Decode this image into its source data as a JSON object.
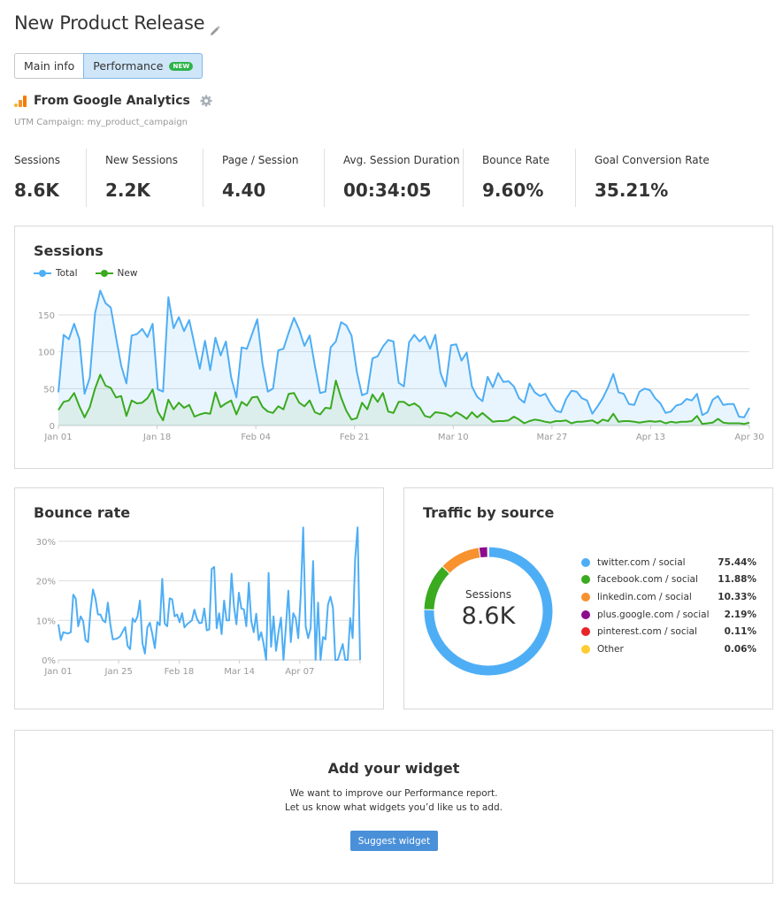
{
  "header": {
    "title": "New Product Release",
    "edit_icon": "pencil-icon"
  },
  "tabs": [
    {
      "label": "Main info",
      "active": false
    },
    {
      "label": "Performance",
      "active": true,
      "badge": "NEW"
    }
  ],
  "source": {
    "label": "From Google Analytics",
    "logo_icon": "google-analytics-logo",
    "settings_icon": "gear-icon",
    "utm": "UTM Campaign: my_product_campaign"
  },
  "metrics": [
    {
      "label": "Sessions",
      "value": "8.6K"
    },
    {
      "label": "New Sessions",
      "value": "2.2K"
    },
    {
      "label": "Page / Session",
      "value": "4.40"
    },
    {
      "label": "Avg. Session Duration",
      "value": "00:34:05"
    },
    {
      "label": "Bounce Rate",
      "value": "9.60%"
    },
    {
      "label": "Goal Conversion Rate",
      "value": "35.21%"
    }
  ],
  "colors": {
    "total": "#4eaef5",
    "new": "#3aaa1f",
    "accent_button": "#4a90d9",
    "badge": "#2db34a"
  },
  "chart_data": [
    {
      "id": "sessions",
      "type": "area",
      "title": "Sessions",
      "xlabel": "",
      "ylabel": "",
      "ylim": [
        0,
        150
      ],
      "yticks": [
        0,
        50,
        100,
        150
      ],
      "grid": true,
      "legend": "top-left",
      "x_tick_labels": [
        "Jan 01",
        "Jan 18",
        "Feb 04",
        "Feb 21",
        "Mar 10",
        "Mar 27",
        "Apr 13",
        "Apr 30"
      ],
      "x_range": [
        "Jan 01",
        "Apr 30"
      ],
      "series": [
        {
          "name": "Total",
          "color": "#4eaef5",
          "values": [
            45,
            123,
            117,
            138,
            117,
            43,
            65,
            152,
            183,
            166,
            160,
            120,
            81,
            57,
            122,
            124,
            131,
            120,
            138,
            49,
            46,
            174,
            132,
            147,
            128,
            143,
            110,
            77,
            115,
            75,
            119,
            95,
            114,
            65,
            38,
            106,
            104,
            124,
            144,
            83,
            46,
            50,
            102,
            104,
            126,
            146,
            130,
            108,
            122,
            81,
            44,
            46,
            106,
            114,
            140,
            136,
            122,
            73,
            41,
            44,
            91,
            94,
            107,
            116,
            114,
            58,
            53,
            113,
            123,
            114,
            121,
            104,
            123,
            71,
            53,
            109,
            110,
            88,
            99,
            53,
            39,
            33,
            66,
            52,
            71,
            59,
            60,
            53,
            37,
            31,
            57,
            45,
            40,
            43,
            30,
            20,
            18,
            36,
            47,
            46,
            37,
            34,
            16,
            26,
            37,
            52,
            70,
            45,
            43,
            29,
            28,
            46,
            50,
            48,
            37,
            30,
            17,
            19,
            27,
            29,
            36,
            34,
            43,
            14,
            18,
            35,
            40,
            28,
            29,
            29,
            12,
            11,
            24
          ]
        },
        {
          "name": "New",
          "color": "#3aaa1f",
          "values": [
            21,
            32,
            34,
            44,
            26,
            11,
            25,
            50,
            69,
            54,
            51,
            38,
            40,
            13,
            34,
            30,
            31,
            37,
            49,
            19,
            7,
            35,
            22,
            31,
            24,
            28,
            12,
            15,
            17,
            16,
            45,
            25,
            30,
            34,
            15,
            32,
            27,
            38,
            39,
            25,
            19,
            17,
            26,
            22,
            43,
            44,
            31,
            26,
            34,
            18,
            15,
            24,
            23,
            61,
            38,
            20,
            8,
            10,
            31,
            22,
            42,
            32,
            44,
            19,
            17,
            32,
            32,
            27,
            30,
            25,
            13,
            11,
            18,
            17,
            16,
            12,
            18,
            14,
            9,
            18,
            11,
            17,
            11,
            5,
            6,
            6,
            7,
            12,
            8,
            3,
            6,
            8,
            7,
            5,
            4,
            6,
            6,
            7,
            3,
            5,
            5,
            6,
            7,
            3,
            8,
            6,
            16,
            5,
            6,
            6,
            5,
            4,
            5,
            6,
            5,
            6,
            3,
            5,
            4,
            5,
            5,
            6,
            13,
            2,
            3,
            4,
            9,
            4,
            3,
            3,
            3,
            2,
            4
          ]
        }
      ]
    },
    {
      "id": "bounce_rate",
      "type": "line",
      "title": "Bounce rate",
      "xlabel": "",
      "ylabel": "",
      "ylim": [
        0,
        30
      ],
      "yticks": [
        "0%",
        "10%",
        "20%",
        "30%"
      ],
      "grid": true,
      "x_tick_labels": [
        "Jan 01",
        "Jan 25",
        "Feb 18",
        "Mar 14",
        "Apr 07"
      ],
      "x_range": [
        "Jan 01",
        "Apr 30"
      ],
      "series": [
        {
          "name": "Bounce rate",
          "color": "#4eaef5",
          "values": [
            9,
            5,
            7,
            6.8,
            6.7,
            7,
            16.5,
            15.5,
            8.5,
            11,
            9.8,
            5,
            4.5,
            12.5,
            17.8,
            15.5,
            11.5,
            11.5,
            10,
            9.5,
            14.5,
            9,
            5.2,
            5.3,
            5.5,
            6,
            7.2,
            8.3,
            3.5,
            2.7,
            10.5,
            9.6,
            11,
            15,
            4.2,
            1.6,
            8.2,
            9.4,
            6.5,
            3,
            9.6,
            8.8,
            20.5,
            9.2,
            8.5,
            15.6,
            15.3,
            11,
            11.5,
            9.5,
            11.8,
            8.2,
            9,
            9.5,
            10,
            12.7,
            10.5,
            9.3,
            9.4,
            13,
            7.5,
            7.7,
            23,
            23.5,
            8,
            11.8,
            6.5,
            15,
            10,
            10,
            21.8,
            13.5,
            9,
            17,
            13,
            12.8,
            8.5,
            19.5,
            9.8,
            7,
            11.7,
            5,
            7,
            4,
            0,
            22,
            3.3,
            11,
            2.3,
            7,
            10.7,
            0,
            8.3,
            17.5,
            4.5,
            11.8,
            10.5,
            5.5,
            16.3,
            33.5,
            8.5,
            5.5,
            8,
            25,
            0,
            14.5,
            0,
            5.8,
            5.2,
            14,
            16,
            13.2,
            0,
            0,
            2,
            4,
            0,
            0,
            10.6,
            5.5,
            25.5,
            33.5,
            0
          ]
        }
      ]
    },
    {
      "id": "traffic_by_source",
      "type": "pie",
      "title": "Traffic by source",
      "center_label": "Sessions",
      "center_value": "8.6K",
      "legend": "right",
      "slices": [
        {
          "label": "twitter.com / social",
          "value": 75.44,
          "display": "75.44%",
          "color": "#4eaef5"
        },
        {
          "label": "facebook.com / social",
          "value": 11.88,
          "display": "11.88%",
          "color": "#3aaa1f"
        },
        {
          "label": "linkedin.com / social",
          "value": 10.33,
          "display": "10.33%",
          "color": "#f7922e"
        },
        {
          "label": "plus.google.com / social",
          "value": 2.19,
          "display": "2.19%",
          "color": "#8c0d8c"
        },
        {
          "label": "pinterest.com / social",
          "value": 0.11,
          "display": "0.11%",
          "color": "#e8242a"
        },
        {
          "label": "Other",
          "value": 0.06,
          "display": "0.06%",
          "color": "#ffcc33"
        }
      ]
    }
  ],
  "widget": {
    "title": "Add your widget",
    "line1": "We want to improve our Performance report.",
    "line2": "Let us know what widgets you’d like us to add.",
    "button": "Suggest widget"
  }
}
